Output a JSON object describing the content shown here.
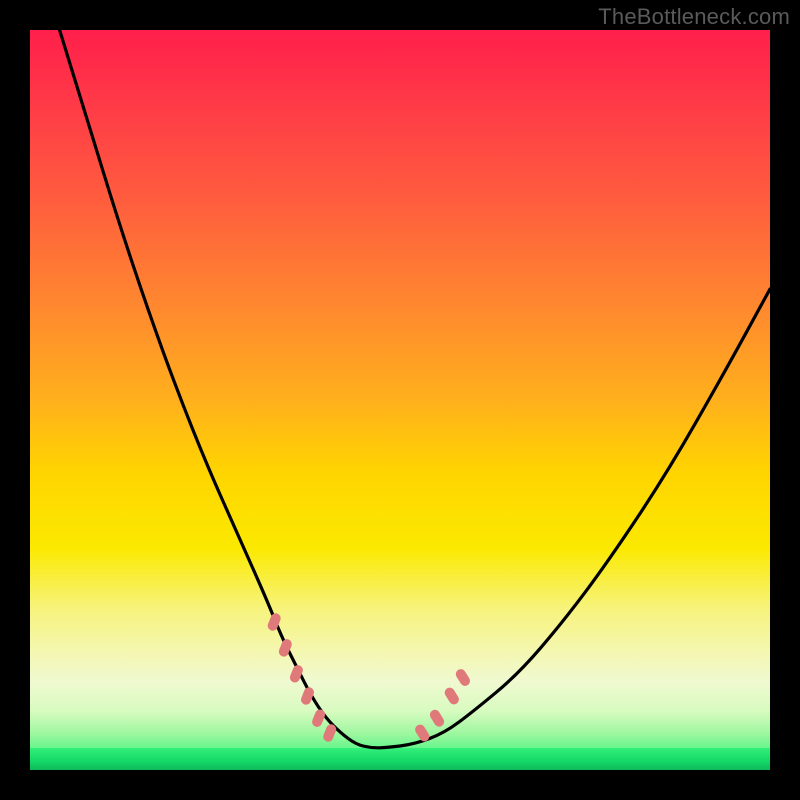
{
  "watermark": "TheBottleneck.com",
  "colors": {
    "background": "#000000",
    "gradient_top": "#ff1f4b",
    "gradient_mid": "#ffd500",
    "gradient_bottom": "#18e56e",
    "curve": "#000000",
    "marker": "#e07a7a"
  },
  "chart_data": {
    "type": "line",
    "title": "",
    "xlabel": "",
    "ylabel": "",
    "xlim": [
      0,
      100
    ],
    "ylim": [
      0,
      100
    ],
    "grid": false,
    "legend": false,
    "series": [
      {
        "name": "bottleneck-curve",
        "x": [
          4,
          8,
          12,
          16,
          20,
          24,
          28,
          32,
          34,
          36,
          38,
          40,
          42,
          44,
          46,
          48,
          52,
          56,
          60,
          66,
          72,
          78,
          86,
          94,
          100
        ],
        "values": [
          100,
          87,
          74,
          62,
          51,
          41,
          32,
          23,
          18,
          14,
          10,
          7,
          5,
          3.5,
          3,
          3,
          3.5,
          5,
          8,
          13,
          20,
          28,
          40,
          54,
          65
        ]
      }
    ],
    "markers": {
      "name": "highlight-points",
      "style": "dashed-pink",
      "points": [
        {
          "x": 33,
          "y": 20
        },
        {
          "x": 34.5,
          "y": 16.5
        },
        {
          "x": 36,
          "y": 13
        },
        {
          "x": 37.5,
          "y": 10
        },
        {
          "x": 39,
          "y": 7
        },
        {
          "x": 40.5,
          "y": 5
        },
        {
          "x": 53,
          "y": 5
        },
        {
          "x": 55,
          "y": 7
        },
        {
          "x": 57,
          "y": 10
        },
        {
          "x": 58.5,
          "y": 12.5
        }
      ]
    }
  }
}
